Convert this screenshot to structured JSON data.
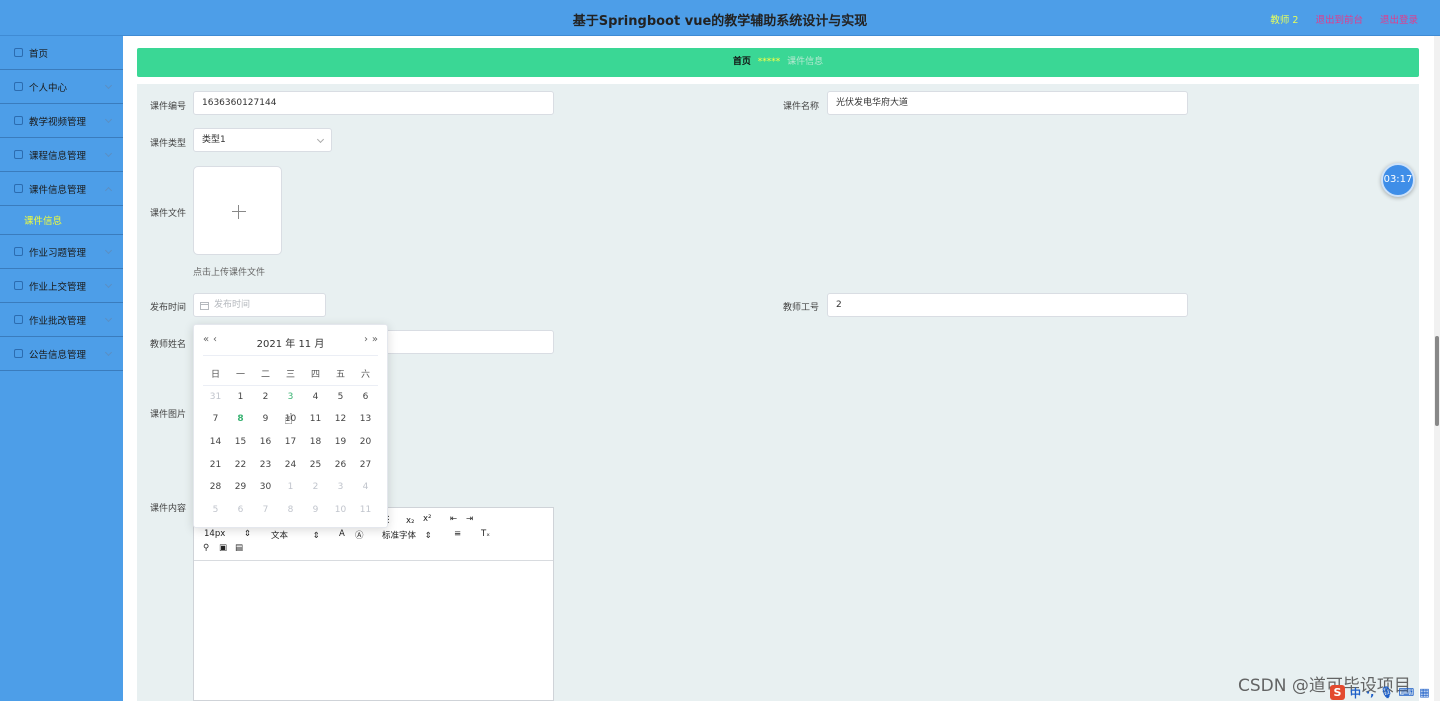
{
  "header": {
    "title": "基于Springboot vue的教学辅助系统设计与实现",
    "user": "教师 2",
    "link_frontend": "退出到前台",
    "link_logout": "退出登录"
  },
  "sidebar": {
    "items": [
      {
        "label": "首页",
        "icon": "home-icon"
      },
      {
        "label": "个人中心",
        "icon": "user-icon"
      },
      {
        "label": "教学视频管理",
        "icon": "video-icon"
      },
      {
        "label": "课程信息管理",
        "icon": "course-icon"
      },
      {
        "label": "课件信息管理",
        "icon": "file-icon"
      },
      {
        "label": "作业习题管理",
        "icon": "exercise-icon"
      },
      {
        "label": "作业上交管理",
        "icon": "upload-icon"
      },
      {
        "label": "作业批改管理",
        "icon": "grade-icon"
      },
      {
        "label": "公告信息管理",
        "icon": "notice-icon"
      }
    ],
    "active_sub": "课件信息"
  },
  "breadcrumb": {
    "home": "首页",
    "sep": "*****",
    "current": "课件信息"
  },
  "form": {
    "code_label": "课件编号",
    "code_value": "1636360127144",
    "name_label": "课件名称",
    "name_value": "光伏发电华府大道",
    "type_label": "课件类型",
    "type_value": "类型1",
    "file_label": "课件文件",
    "file_hint": "点击上传课件文件",
    "date_label": "发布时间",
    "date_placeholder": "发布时间",
    "teacher_id_label": "教师工号",
    "teacher_id_value": "2",
    "teacher_name_label": "教师姓名",
    "image_label": "课件图片",
    "content_label": "课件内容"
  },
  "editor": {
    "font_size": "14px",
    "text_style": "文本",
    "font_family": "标准字体"
  },
  "datepicker": {
    "year_month": "2021 年  11 月",
    "weekdays": [
      "日",
      "一",
      "二",
      "三",
      "四",
      "五",
      "六"
    ],
    "weeks": [
      [
        "31",
        "1",
        "2",
        "3",
        "4",
        "5",
        "6"
      ],
      [
        "7",
        "8",
        "9",
        "10",
        "11",
        "12",
        "13"
      ],
      [
        "14",
        "15",
        "16",
        "17",
        "18",
        "19",
        "20"
      ],
      [
        "21",
        "22",
        "23",
        "24",
        "25",
        "26",
        "27"
      ],
      [
        "28",
        "29",
        "30",
        "1",
        "2",
        "3",
        "4"
      ],
      [
        "5",
        "6",
        "7",
        "8",
        "9",
        "10",
        "11"
      ]
    ]
  },
  "timer": "03:17",
  "watermark": "CSDN @道可毕设项目",
  "colors": {
    "topbar": "#4d9ee8",
    "breadcrumb": "#3ad795",
    "accent_today": "#3ab373",
    "sub_active": "#f2ff3a"
  }
}
